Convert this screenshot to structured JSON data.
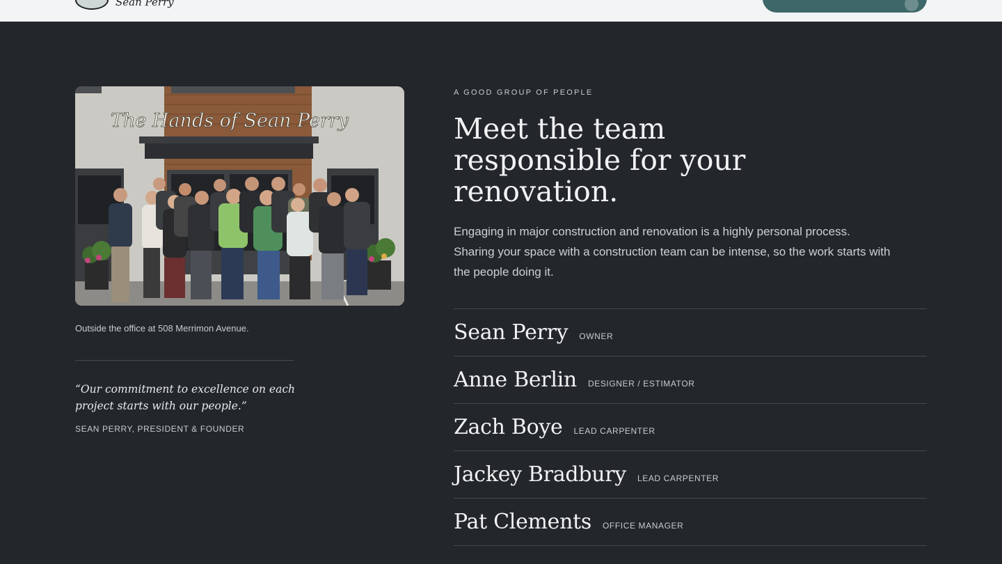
{
  "header": {
    "logo_text": "Sean Perry"
  },
  "colors": {
    "background": "#23272b",
    "header_bg": "#f3f4f5",
    "cta": "#3d6769"
  },
  "photo": {
    "sign_text": "The Hands of Sean Perry",
    "caption": "Outside the office at 508 Merrimon Avenue."
  },
  "quote": {
    "text": "“Our commitment to excellence on each project starts with our people.”",
    "attribution": "SEAN PERRY, PRESIDENT & FOUNDER"
  },
  "intro": {
    "eyebrow": "A GOOD GROUP OF PEOPLE",
    "headline": "Meet the team responsible for your renovation.",
    "lede": "Engaging in major construction and renovation is a highly personal process. Sharing your space with a construction team can be intense, so the work starts with the people doing it."
  },
  "team": [
    {
      "name": "Sean Perry",
      "role": "OWNER"
    },
    {
      "name": "Anne Berlin",
      "role": "DESIGNER / ESTIMATOR"
    },
    {
      "name": "Zach Boye",
      "role": "LEAD CARPENTER"
    },
    {
      "name": "Jackey Bradbury",
      "role": "LEAD CARPENTER"
    },
    {
      "name": "Pat Clements",
      "role": "OFFICE MANAGER"
    }
  ]
}
